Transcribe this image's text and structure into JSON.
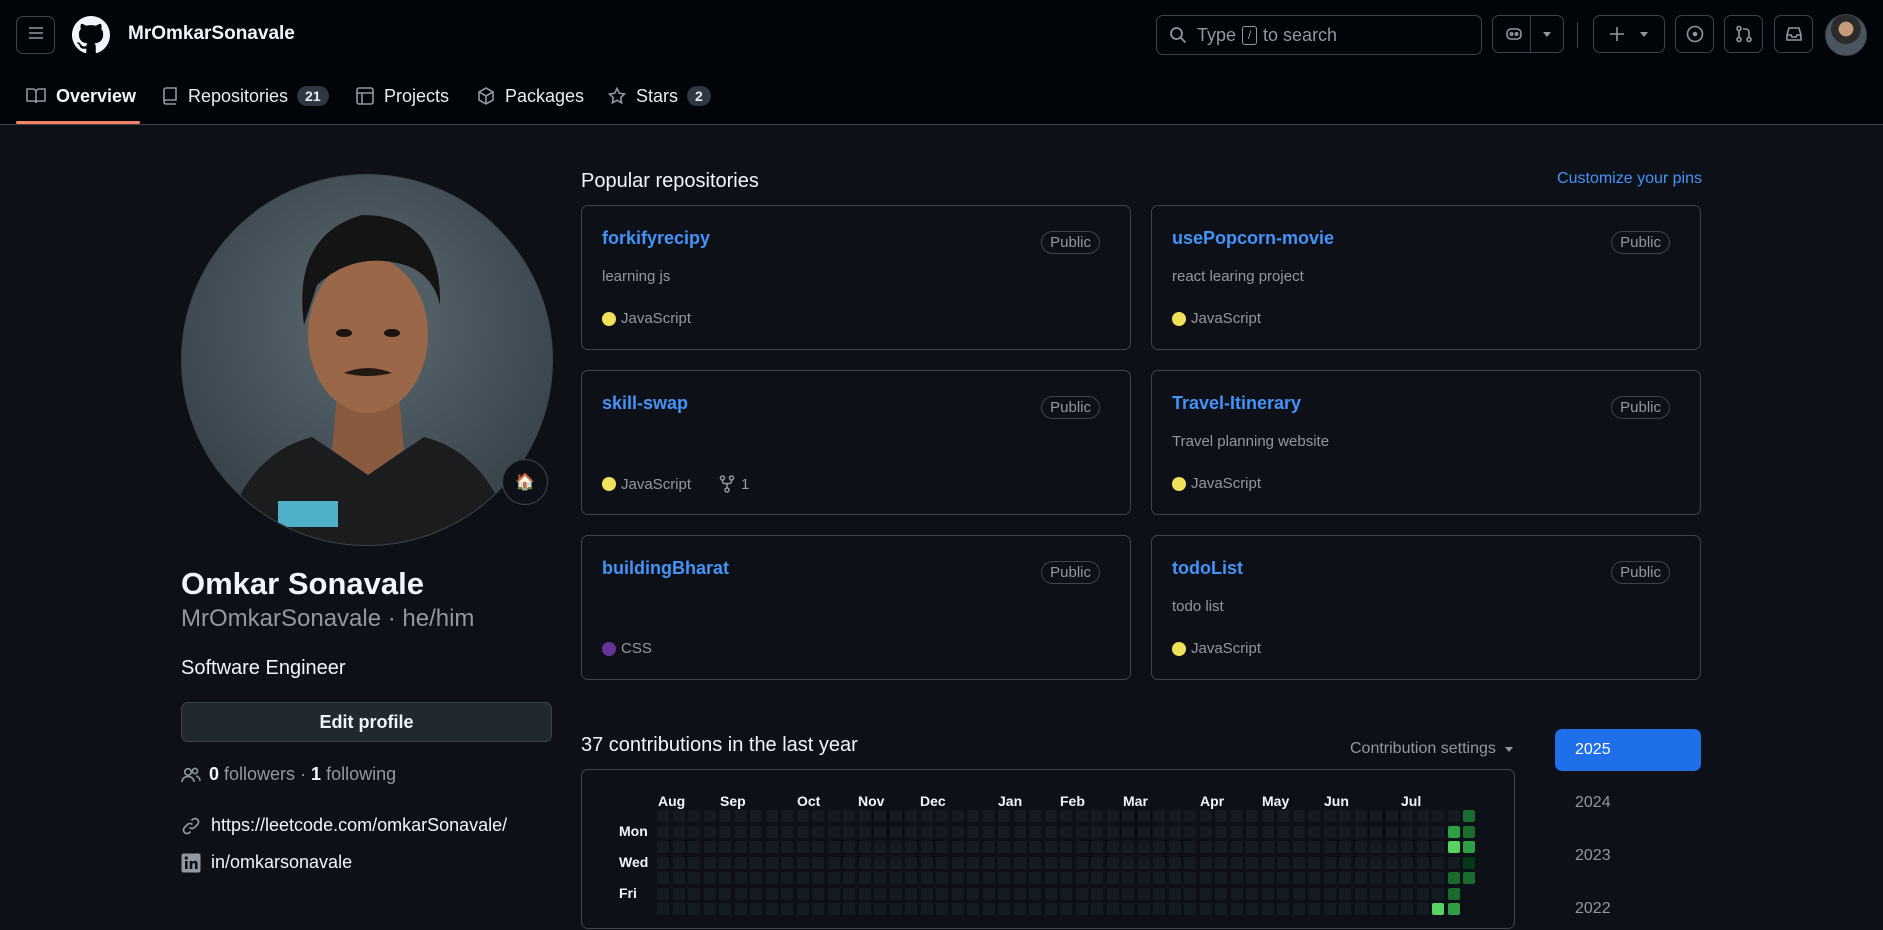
{
  "header": {
    "username": "MrOmkarSonavale",
    "search_prefix": "Type",
    "search_key": "/",
    "search_suffix": "to search"
  },
  "tabs": [
    {
      "label": "Overview",
      "icon": "book-icon"
    },
    {
      "label": "Repositories",
      "count": "21",
      "icon": "repo-icon"
    },
    {
      "label": "Projects",
      "icon": "table-icon"
    },
    {
      "label": "Packages",
      "icon": "package-icon"
    },
    {
      "label": "Stars",
      "count": "2",
      "icon": "star-icon"
    }
  ],
  "profile": {
    "name": "Omkar Sonavale",
    "handle": "MrOmkarSonavale · he/him",
    "bio": "Software Engineer",
    "status_emoji": "🏠",
    "edit_label": "Edit profile",
    "followers_count": "0",
    "followers_label": "followers ·",
    "following_count": "1",
    "following_label": "following",
    "website": "https://leetcode.com/omkarSonavale/",
    "linkedin": "in/omkarsonavale"
  },
  "popular": {
    "title": "Popular repositories",
    "customize": "Customize your pins",
    "repos": [
      {
        "name": "forkifyrecipy",
        "badge": "Public",
        "desc": "learning js",
        "lang": "JavaScript",
        "lang_color": "#f1e05a",
        "forks": ""
      },
      {
        "name": "usePopcorn-movie",
        "badge": "Public",
        "desc": "react learing project",
        "lang": "JavaScript",
        "lang_color": "#f1e05a",
        "forks": ""
      },
      {
        "name": "skill-swap",
        "badge": "Public",
        "desc": "",
        "lang": "JavaScript",
        "lang_color": "#f1e05a",
        "forks": "1"
      },
      {
        "name": "Travel-Itinerary",
        "badge": "Public",
        "desc": "Travel planning website",
        "lang": "JavaScript",
        "lang_color": "#f1e05a",
        "forks": ""
      },
      {
        "name": "buildingBharat",
        "badge": "Public",
        "desc": "",
        "lang": "CSS",
        "lang_color": "#663399",
        "forks": ""
      },
      {
        "name": "todoList",
        "badge": "Public",
        "desc": "todo list",
        "lang": "JavaScript",
        "lang_color": "#f1e05a",
        "forks": ""
      }
    ]
  },
  "contributions": {
    "title": "37 contributions in the last year",
    "settings_label": "Contribution settings",
    "months": [
      "Aug",
      "Sep",
      "Oct",
      "Nov",
      "Dec",
      "Jan",
      "Feb",
      "Mar",
      "Apr",
      "May",
      "Jun",
      "Jul"
    ],
    "days": [
      "Mon",
      "Wed",
      "Fri"
    ],
    "years": [
      "2025",
      "2024",
      "2023",
      "2022"
    ],
    "active_year": "2025",
    "level_colors": [
      "#151b23",
      "#033a16",
      "#196c2e",
      "#2ea043",
      "#56d364"
    ]
  }
}
